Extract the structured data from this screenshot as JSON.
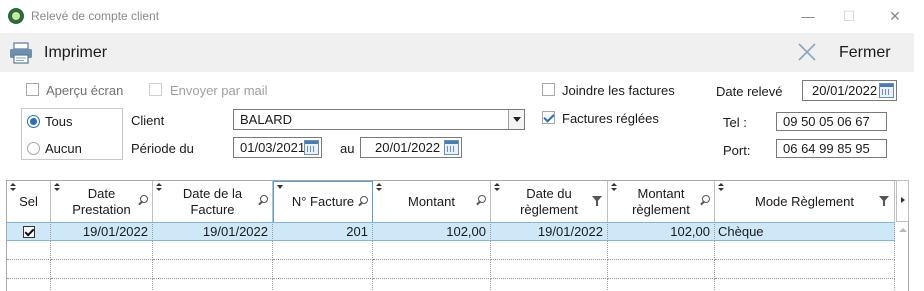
{
  "window": {
    "title": "Relevé de compte client"
  },
  "toolbar": {
    "print_label": "Imprimer",
    "close_label": "Fermer"
  },
  "options": {
    "apercu": {
      "label": "Aperçu écran",
      "checked": false
    },
    "mail": {
      "label": "Envoyer par mail",
      "checked": false,
      "disabled": true
    },
    "joindre": {
      "label": "Joindre les factures",
      "checked": false
    },
    "reglees": {
      "label": "Factures réglées",
      "checked": true
    }
  },
  "filter": {
    "tous_label": "Tous",
    "aucun_label": "Aucun",
    "selected": "Tous",
    "client_label": "Client",
    "client_value": "BALARD",
    "periode_label": "Période du",
    "periode_from": "01/03/2021",
    "au_label": "au",
    "periode_to": "20/01/2022"
  },
  "info": {
    "date_releve_label": "Date relevé",
    "date_releve": "20/01/2022",
    "tel_label": "Tel :",
    "tel": "09 50 05 06 67",
    "port_label": "Port:",
    "port": "06 64 99 85 95"
  },
  "grid": {
    "columns": [
      "Sel",
      "Date Prestation",
      "Date de la Facture",
      "N° Facture",
      "Montant",
      "Date du règlement",
      "Montant règlement",
      "Mode Règlement"
    ],
    "rows": [
      {
        "sel": true,
        "date_prestation": "19/01/2022",
        "date_facture": "19/01/2022",
        "numero": "201",
        "montant": "102,00",
        "date_reglement": "19/01/2022",
        "montant_reglement": "102,00",
        "mode": "Chèque"
      }
    ]
  }
}
